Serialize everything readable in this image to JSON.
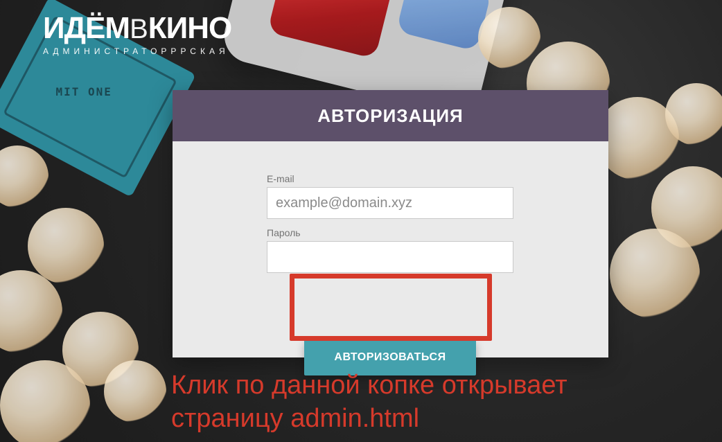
{
  "brand": {
    "title_left": "ИДЁМ",
    "title_mid": "В",
    "title_right": "КИНО",
    "subtitle": "АДМИНИСТРАТОРРРСКАЯ"
  },
  "background": {
    "ticket_text": "MIT ONE"
  },
  "auth": {
    "title": "АВТОРИЗАЦИЯ",
    "email": {
      "label": "E-mail",
      "value": "",
      "placeholder": "example@domain.xyz"
    },
    "password": {
      "label": "Пароль",
      "value": "",
      "placeholder": ""
    },
    "submit_label": "АВТОРИЗОВАТЬСЯ"
  },
  "annotation": {
    "line1": "Клик по данной копке открывает",
    "line2": "страницу admin.html"
  },
  "colors": {
    "header_purple": "#5d506a",
    "button_teal": "#44a1ad",
    "highlight_red": "#d63a2b",
    "card_bg": "#eaeaea"
  }
}
